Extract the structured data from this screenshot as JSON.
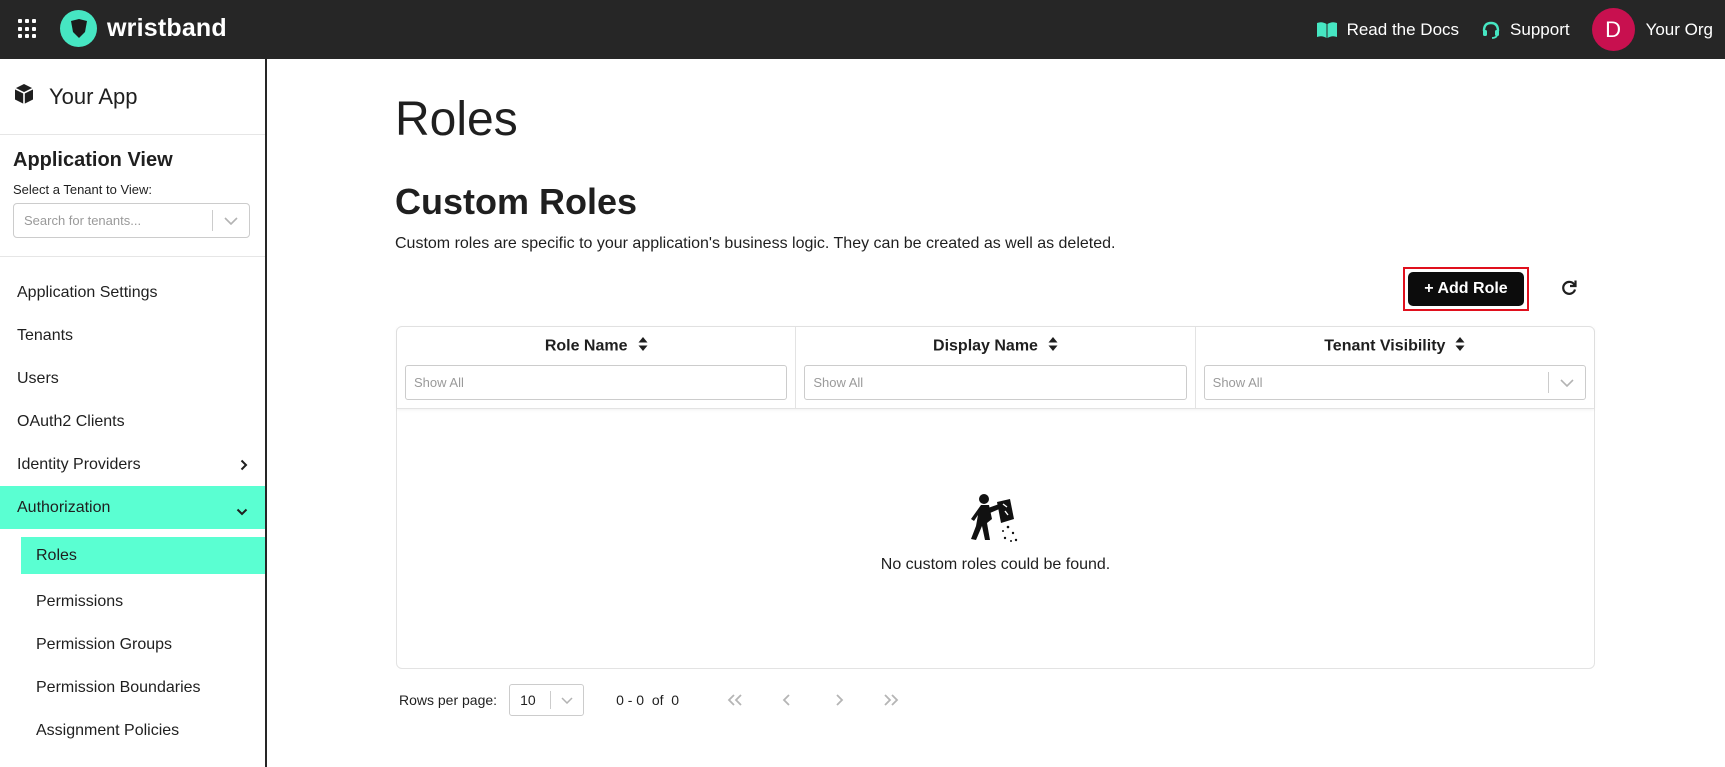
{
  "header": {
    "brand": "wristband",
    "docs_label": "Read the Docs",
    "support_label": "Support",
    "avatar_initial": "D",
    "org_name": "Your Org"
  },
  "sidebar": {
    "app_name": "Your App",
    "app_view_title": "Application View",
    "tenant_label": "Select a Tenant to View:",
    "tenant_placeholder": "Search for tenants...",
    "items": [
      {
        "label": "Application Settings"
      },
      {
        "label": "Tenants"
      },
      {
        "label": "Users"
      },
      {
        "label": "OAuth2 Clients"
      },
      {
        "label": "Identity Providers"
      },
      {
        "label": "Authorization"
      }
    ],
    "subitems": [
      {
        "label": "Roles"
      },
      {
        "label": "Permissions"
      },
      {
        "label": "Permission Groups"
      },
      {
        "label": "Permission Boundaries"
      },
      {
        "label": "Assignment Policies"
      }
    ]
  },
  "main": {
    "page_title": "Roles",
    "section_title": "Custom Roles",
    "section_desc": "Custom roles are specific to your application's business logic. They can be created as well as deleted.",
    "add_role_label": "+ Add Role",
    "columns": [
      {
        "label": "Role Name",
        "filter_placeholder": "Show All"
      },
      {
        "label": "Display Name",
        "filter_placeholder": "Show All"
      },
      {
        "label": "Tenant Visibility",
        "filter_placeholder": "Show All"
      }
    ],
    "empty_text": "No custom roles could be found.",
    "pager": {
      "rows_label": "Rows per page:",
      "rows_value": "10",
      "range": "0 - 0  of  0"
    }
  },
  "colors": {
    "topbar": "#262626",
    "accent": "#5affd2",
    "avatar": "#c8104f",
    "highlight_border": "#e0101d"
  }
}
